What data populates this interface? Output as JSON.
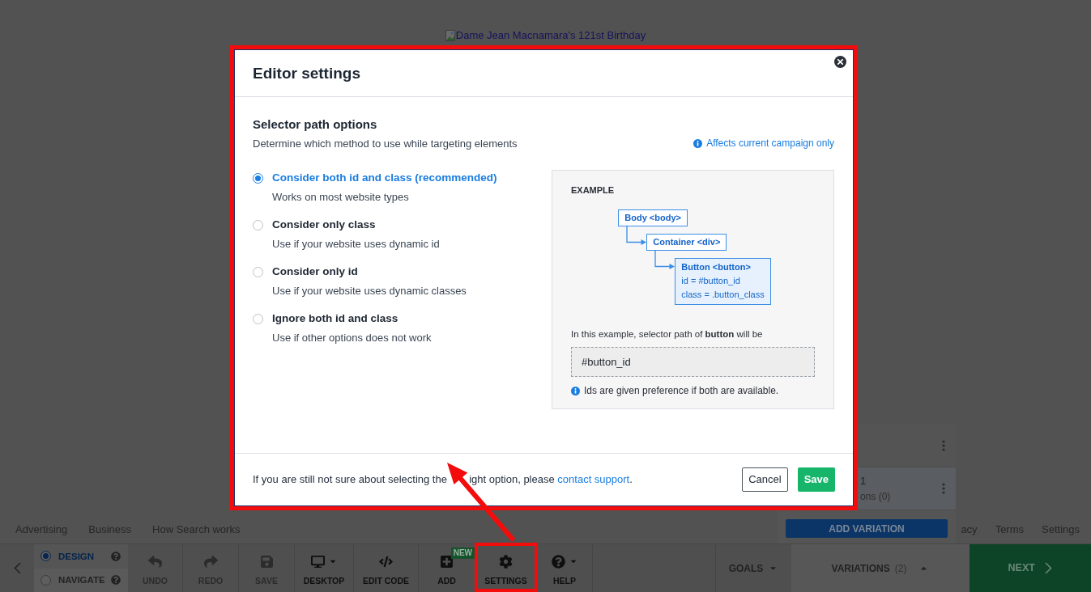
{
  "page": {
    "image_alt": "Dame Jean Macnamara's 121st Birthday",
    "footer_links_left": [
      "Advertising",
      "Business",
      "How Search works"
    ],
    "footer_links_right": [
      "acy",
      "Terms",
      "Settings"
    ]
  },
  "variations_panel": {
    "rows": [
      {
        "selected": false
      },
      {
        "title": "1",
        "subtitle": "ons (0)",
        "selected": true
      }
    ],
    "add_button": "ADD VARIATION"
  },
  "toolbar": {
    "modes": [
      {
        "label": "DESIGN",
        "selected": true
      },
      {
        "label": "NAVIGATE",
        "selected": false
      }
    ],
    "tools": [
      {
        "kind": "undo",
        "label": "UNDO",
        "disabled": true,
        "dropdown": false
      },
      {
        "kind": "redo",
        "label": "REDO",
        "disabled": true,
        "dropdown": false
      },
      {
        "kind": "save",
        "label": "SAVE",
        "disabled": true,
        "dropdown": false
      },
      {
        "kind": "desktop",
        "label": "DESKTOP",
        "disabled": false,
        "dropdown": true
      },
      {
        "kind": "code",
        "label": "EDIT CODE",
        "disabled": false,
        "dropdown": false
      },
      {
        "kind": "add",
        "label": "ADD",
        "disabled": false,
        "dropdown": false,
        "badge": "NEW"
      },
      {
        "kind": "settings",
        "label": "SETTINGS",
        "disabled": false,
        "dropdown": false
      },
      {
        "kind": "help",
        "label": "HELP",
        "disabled": false,
        "dropdown": true
      }
    ],
    "goals": "GOALS",
    "variations": {
      "label": "VARIATIONS",
      "count": "(2)"
    },
    "next": "NEXT"
  },
  "modal": {
    "title": "Editor settings",
    "section_title": "Selector path options",
    "section_description": "Determine which method to use while targeting elements",
    "scope_note": "Affects current campaign only",
    "options": [
      {
        "label": "Consider both id and class (recommended)",
        "description": "Works on most website types",
        "selected": true
      },
      {
        "label": "Consider only class",
        "description": "Use if your website uses dynamic id",
        "selected": false
      },
      {
        "label": "Consider only id",
        "description": "Use if your website uses dynamic classes",
        "selected": false
      },
      {
        "label": "Ignore both id and class",
        "description": "Use if other options does not work",
        "selected": false
      }
    ],
    "example": {
      "heading": "EXAMPLE",
      "tree": [
        {
          "label": "Body <body>",
          "selected": false,
          "children": [
            {
              "label": "Container <div>",
              "selected": false,
              "children": [
                {
                  "label": "Button <button>",
                  "lines": [
                    "id = #button_id",
                    "class = .button_class"
                  ],
                  "selected": true
                }
              ]
            }
          ]
        }
      ],
      "caption": "In this example, selector path of **button** will be",
      "result": "#button_id",
      "note": "Ids are given preference if both are available."
    },
    "footer_text_parts": [
      "If you are still not sure about selecting the",
      "ight option, please"
    ],
    "footer_link": "contact support",
    "footer_tail": ".",
    "buttons": [
      {
        "label": "Cancel",
        "kind": "secondary"
      },
      {
        "label": "Save",
        "kind": "primary"
      }
    ]
  }
}
